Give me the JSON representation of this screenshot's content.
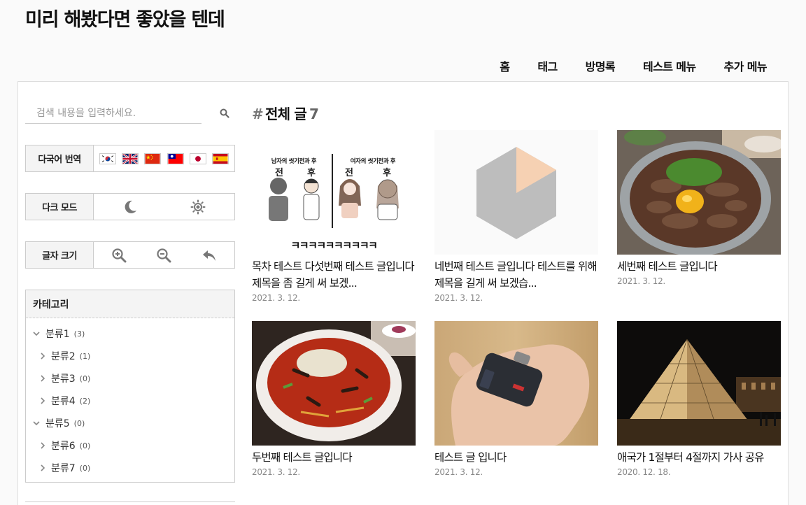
{
  "site": {
    "title": "미리 해봤다면 좋았을 텐데"
  },
  "nav": [
    {
      "label": "홈"
    },
    {
      "label": "태그"
    },
    {
      "label": "방명록"
    },
    {
      "label": "테스트 메뉴"
    },
    {
      "label": "추가 메뉴"
    }
  ],
  "sidebar": {
    "search_placeholder": "검색 내용을 입력하세요.",
    "translate_label": "다국어 번역",
    "translate_flags": [
      "korea-flag-icon",
      "uk-flag-icon",
      "china-flag-icon",
      "taiwan-flag-icon",
      "japan-flag-icon",
      "spain-flag-icon"
    ],
    "darkmode_label": "다크 모드",
    "fontsize_label": "글자 크기",
    "category_title": "카테고리",
    "categories": [
      {
        "label": "분류1",
        "count": "(3)",
        "expanded": true
      },
      {
        "label": "분류2",
        "count": "(1)"
      },
      {
        "label": "분류3",
        "count": "(0)"
      },
      {
        "label": "분류4",
        "count": "(2)"
      },
      {
        "label": "분류5",
        "count": "(0)",
        "expanded": true
      },
      {
        "label": "분류6",
        "count": "(0)"
      },
      {
        "label": "분류7",
        "count": "(0)"
      }
    ]
  },
  "content": {
    "hash": "#",
    "heading": "전체 글",
    "count": "7",
    "posts": [
      {
        "title": "목차 테스트 다섯번째 테스트 글입니다 제목을 좀 길게 써 보겠...",
        "date": "2021. 3. 12.",
        "thumb_text_left": "남자의 씻기전과 후",
        "thumb_text_right": "여자의 씻기전과 후",
        "thumb_before": "전",
        "thumb_after": "후",
        "thumb_caption": "ㅋㅋㅋㅋㅋㅋㅋㅋㅋㅋ"
      },
      {
        "title": "네번째 테스트 글입니다 테스트를 위해 제목을 길게 써 보겠습...",
        "date": "2021. 3. 12."
      },
      {
        "title": "세번째 테스트 글입니다",
        "date": "2021. 3. 12."
      },
      {
        "title": "두번째 테스트 글입니다",
        "date": "2021. 3. 12."
      },
      {
        "title": "테스트 글 입니다",
        "date": "2021. 3. 12."
      },
      {
        "title": "애국가 1절부터 4절까지 가사 공유",
        "date": "2020. 12. 18."
      }
    ]
  }
}
